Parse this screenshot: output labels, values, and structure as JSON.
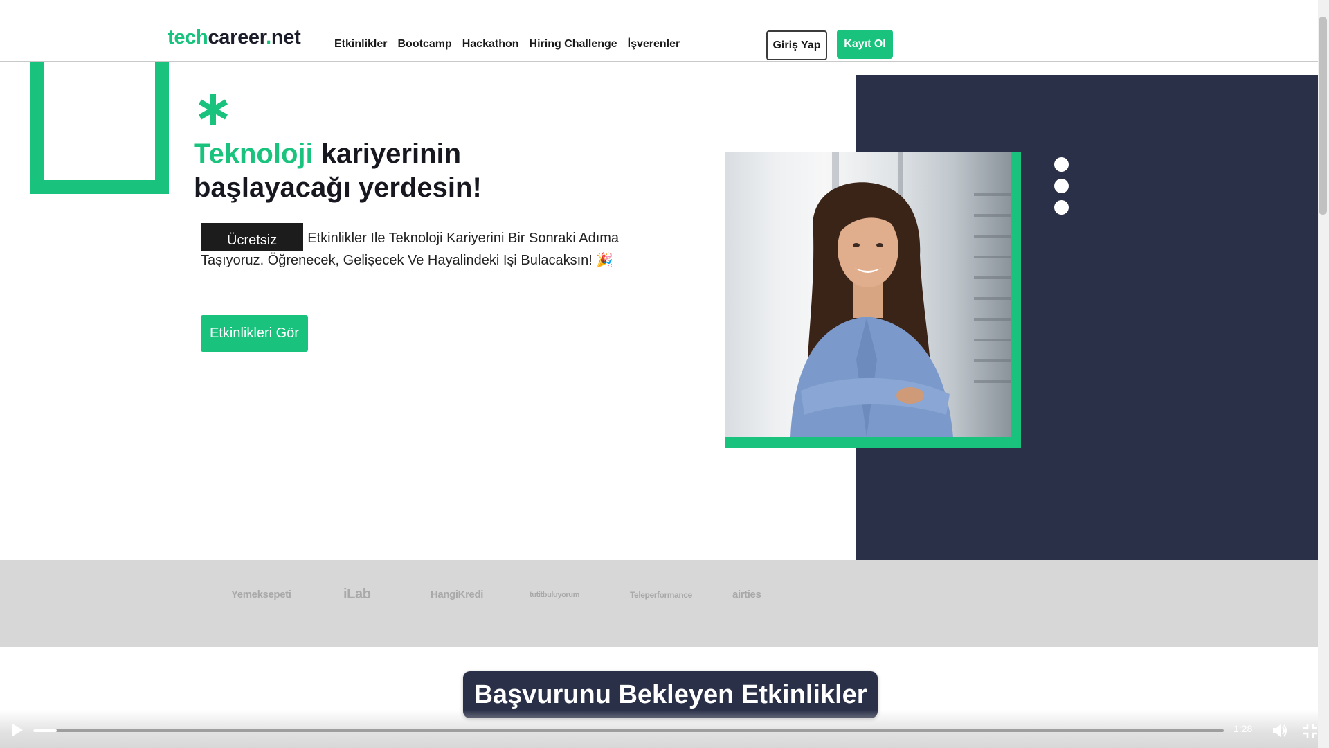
{
  "header": {
    "logo_tech": "tech",
    "logo_career": "career",
    "logo_dot": ".",
    "logo_net": "net",
    "nav": [
      "Etkinlikler",
      "Bootcamp",
      "Hackathon",
      "Hiring Challenge",
      "İşverenler"
    ],
    "login_label": "Giriş Yap",
    "signup_label": "Kayıt Ol"
  },
  "hero": {
    "title_highlight": "Teknoloji",
    "title_rest_line1": " kariyerinin",
    "title_line2": "başlayacağı yerdesin!",
    "tag": "Ücretsiz",
    "description": "Etkinlikler Ile Teknoloji Kariyerini Bir Sonraki Adıma Taşıyoruz. Öğrenecek, Gelişecek Ve Hayalindeki Işi Bulacaksın! 🎉",
    "cta_label": "Etkinlikleri Gör"
  },
  "brands": [
    "Yemeksepeti",
    "iLab",
    "HangiKredi",
    "tutitbuluyorum",
    "Teleperformance",
    "airties"
  ],
  "caption": "Başvurunu Bekleyen Etkinlikler",
  "video": {
    "time": "1:28",
    "progress_fraction": 0.02
  },
  "colors": {
    "accent": "#19c37d",
    "navy": "#2a3048"
  }
}
